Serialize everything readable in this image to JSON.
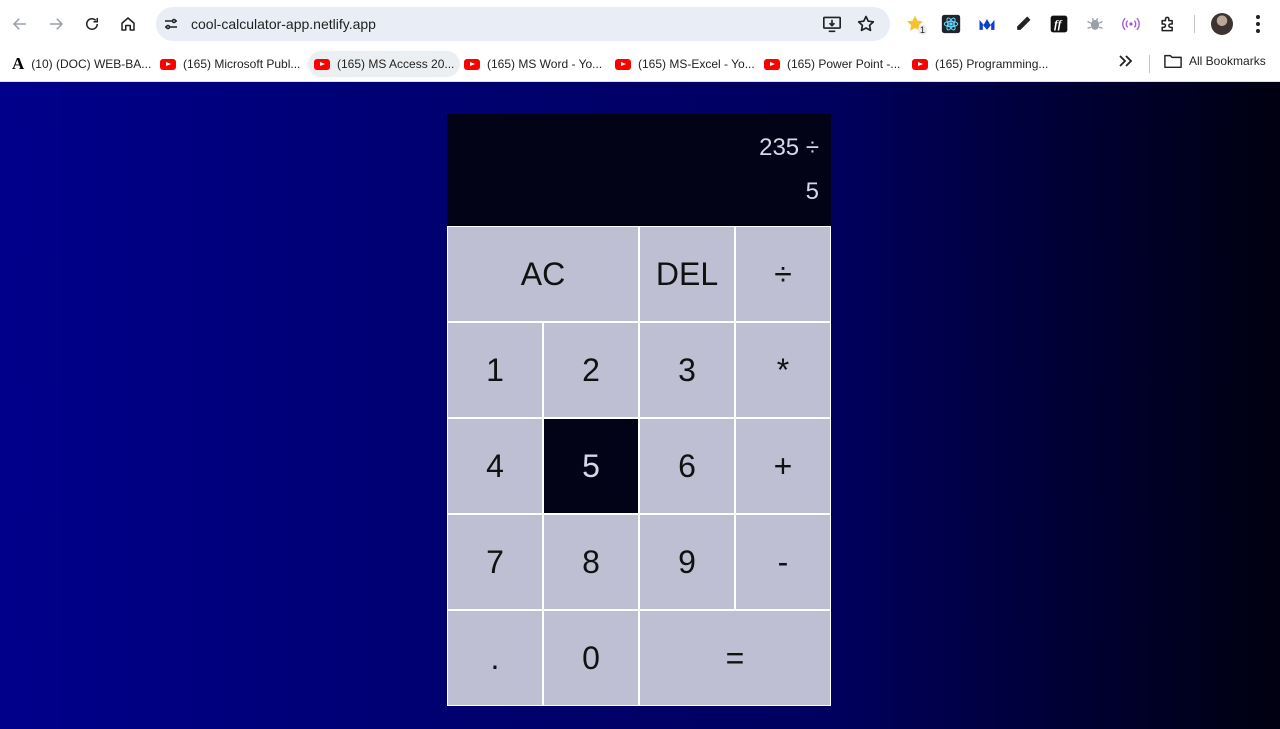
{
  "browser": {
    "url": "cool-calculator-app.netlify.app",
    "extension_badge": "1",
    "bookmarks": [
      {
        "label": "(10) (DOC) WEB-BA...",
        "icon": "academia-icon"
      },
      {
        "label": "(165) Microsoft Publ...",
        "icon": "youtube-icon"
      },
      {
        "label": "(165) MS Access 20...",
        "icon": "youtube-icon"
      },
      {
        "label": "(165) MS Word - Yo...",
        "icon": "youtube-icon"
      },
      {
        "label": "(165) MS-Excel - Yo...",
        "icon": "youtube-icon"
      },
      {
        "label": "(165) Power Point -...",
        "icon": "youtube-icon"
      },
      {
        "label": "(165) Programming...",
        "icon": "youtube-icon"
      }
    ],
    "all_bookmarks_label": "All Bookmarks"
  },
  "calculator": {
    "previous_operand": "235 ÷",
    "current_operand": "5",
    "keys": [
      {
        "label": "AC"
      },
      {
        "label": "DEL"
      },
      {
        "label": "÷"
      },
      {
        "label": "1"
      },
      {
        "label": "2"
      },
      {
        "label": "3"
      },
      {
        "label": "*"
      },
      {
        "label": "4"
      },
      {
        "label": "5"
      },
      {
        "label": "6"
      },
      {
        "label": "+"
      },
      {
        "label": "7"
      },
      {
        "label": "8"
      },
      {
        "label": "9"
      },
      {
        "label": "-"
      },
      {
        "label": "."
      },
      {
        "label": "0"
      },
      {
        "label": "="
      }
    ],
    "pressed_key": "5"
  },
  "colors": {
    "background_left": "#00008b",
    "background_right": "#000010",
    "display_bg": "#030317",
    "key_bg": "#bfbfd3",
    "key_pressed_bg": "#030317"
  }
}
